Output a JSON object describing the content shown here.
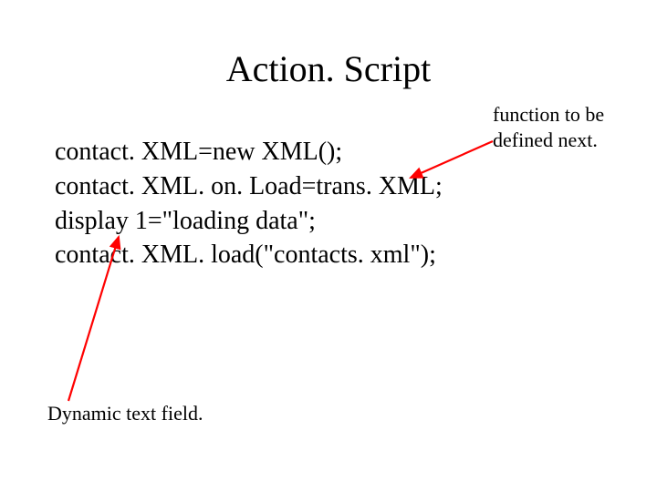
{
  "title": "Action. Script",
  "code": {
    "line1": "contact. XML=new XML();",
    "line2": "contact. XML. on. Load=trans. XML;",
    "line3": "display 1=\"loading data\";",
    "line4": "contact. XML. load(\"contacts. xml\");"
  },
  "annotations": {
    "right": "function to be defined next.",
    "bottom": "Dynamic text field."
  },
  "colors": {
    "arrow": "#ff0000"
  }
}
